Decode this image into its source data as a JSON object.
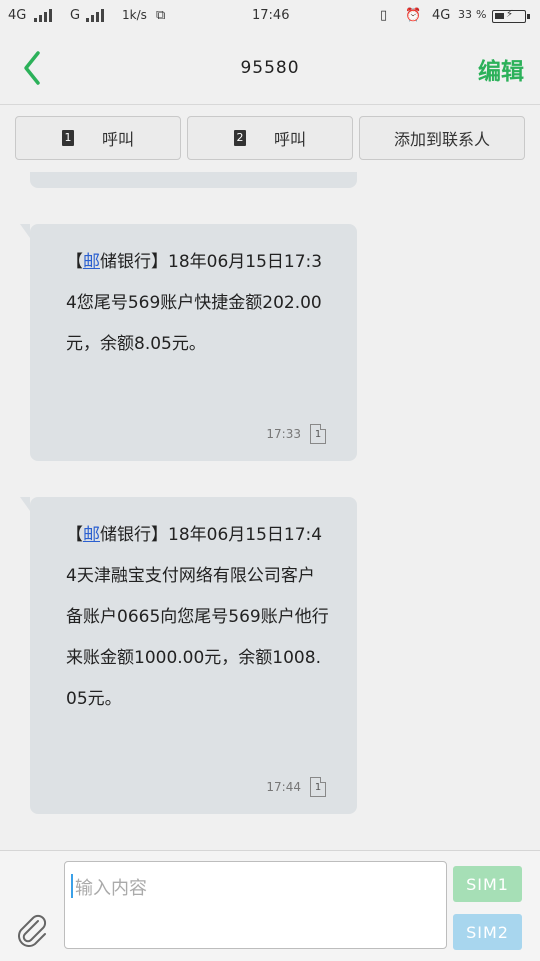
{
  "status_bar": {
    "network_left": "4G",
    "network_mid": "G",
    "speed": "1k/s",
    "time": "17:46",
    "network_right": "4G",
    "battery": "33"
  },
  "header": {
    "title": "95580",
    "edit_label": "编辑"
  },
  "actions": {
    "call1_sim": "1",
    "call1_label": "呼叫",
    "call2_sim": "2",
    "call2_label": "呼叫",
    "add_contact_label": "添加到联系人"
  },
  "messages": [
    {
      "bracket_open": "【",
      "link": "邮",
      "text": "储银行】18年06月15日17:34您尾号569账户快捷金额202.00元，余额8.05元。",
      "time": "17:33",
      "sim": "1"
    },
    {
      "bracket_open": "【",
      "link": "邮",
      "text": "储银行】18年06月15日17:44天津融宝支付网络有限公司客户备账户0665向您尾号569账户他行来账金额1000.00元，余额1008.05元。",
      "time": "17:44",
      "sim": "1"
    }
  ],
  "composer": {
    "placeholder": "输入内容",
    "sim1_label": "SIM1",
    "sim2_label": "SIM2"
  },
  "colors": {
    "accent": "#2cb15a",
    "link": "#2a5fd0",
    "bubble": "#dde1e4",
    "sim1": "#a6dfb6",
    "sim2": "#a8d6ee"
  }
}
